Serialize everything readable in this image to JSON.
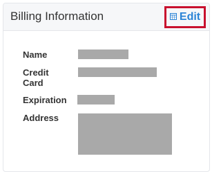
{
  "card": {
    "title": "Billing Information",
    "edit_label": "Edit",
    "edit_icon": "calendar-icon"
  },
  "fields": {
    "name_label": "Name",
    "credit_card_label": "Credit Card",
    "expiration_label": "Expiration",
    "address_label": "Address"
  },
  "colors": {
    "edit_link": "#2a83d6",
    "highlight_border": "#c8102e",
    "redaction": "#a9a9a9"
  }
}
